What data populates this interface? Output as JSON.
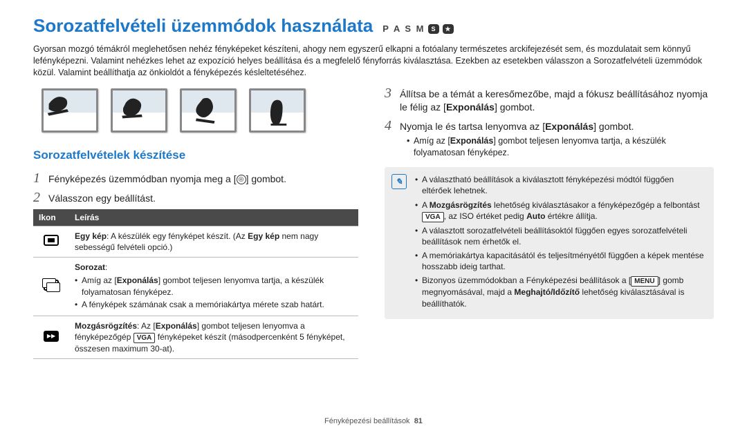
{
  "header": {
    "title": "Sorozatfelvételi üzemmódok használata",
    "mode_letters": "P A S M",
    "mode_badge1": "S",
    "mode_badge2": "★"
  },
  "intro": "Gyorsan mozgó témákról meglehetősen nehéz fényképeket készíteni, ahogy nem egyszerű elkapni a fotóalany természetes arckifejezését sem, és mozdulatait sem könnyű lefényképezni. Valamint nehézkes lehet az expozíció helyes beállítása és a megfelelő fényforrás kiválasztása. Ezekben az esetekben válasszon a Sorozatfelvételi üzemmódok közül. Valamint beállíthatja az önkioldót a fényképezés késleltetéséhez.",
  "section_sub": "Sorozatfelvételek készítése",
  "steps_left": {
    "s1_pre": "Fényképezés üzemmódban nyomja meg a [",
    "s1_post": "] gombot.",
    "s2": "Válasszon egy beállítást."
  },
  "table": {
    "h1": "Ikon",
    "h2": "Leírás",
    "r1_strong": "Egy kép",
    "r1_rest": ": A készülék egy fényképet készít. (Az ",
    "r1_strong2": "Egy kép",
    "r1_rest2": " nem nagy sebességű felvételi opció.)",
    "r2_strong": "Sorozat",
    "r2_rest": ":",
    "r2_b1_pre": "Amíg az [",
    "r2_b1_mid": "Exponálás",
    "r2_b1_post": "] gombot teljesen lenyomva tartja, a készülék folyamatosan fényképez.",
    "r2_b2": "A fényképek számának csak a memóriakártya mérete szab határt.",
    "r3_strong": "Mozgásrögzítés",
    "r3_rest_pre": ": Az [",
    "r3_rest_mid": "Exponálás",
    "r3_rest_post1": "] gombot teljesen lenyomva a fényképezőgép ",
    "r3_btn": "VGA",
    "r3_rest_post2": " fényképeket készít (másodpercenként 5 fényképet, összesen maximum 30-at)."
  },
  "steps_right": {
    "s3": "Állítsa be a témát a keresőmezőbe, majd a fókusz beállításához nyomja le félig az [",
    "s3_mid": "Exponálás",
    "s3_post": "] gombot.",
    "s4_pre": "Nyomja le és tartsa lenyomva az [",
    "s4_mid": "Exponálás",
    "s4_post": "] gombot.",
    "s4_b1_pre": "Amíg az [",
    "s4_b1_mid": "Exponálás",
    "s4_b1_post": "] gombot teljesen lenyomva tartja, a készülék folyamatosan fényképez."
  },
  "notes": {
    "n1": "A választható beállítások a kiválasztott fényképezési módtól függően eltérőek lehetnek.",
    "n2_pre": "A ",
    "n2_strong": "Mozgásrögzítés",
    "n2_mid": " lehetőség kiválasztásakor a fényképezőgép a felbontást ",
    "n2_btn": "VGA",
    "n2_post": ", az ISO értéket pedig ",
    "n2_strong2": "Auto",
    "n2_end": " értékre állítja.",
    "n3": "A választott sorozatfelvételi beállításoktól függően egyes sorozatfelvételi beállítások nem érhetők el.",
    "n4": "A memóriakártya kapacitásától és teljesítményétől függően a képek mentése hosszabb ideig tarthat.",
    "n5_pre": "Bizonyos üzemmódokban a Fényképezési beállítások a [",
    "n5_btn": "MENU",
    "n5_mid": "] gomb megnyomásával, majd a ",
    "n5_strong": "Meghajtó/Időzítő",
    "n5_post": " lehetőség kiválasztásával is beállíthatók."
  },
  "footer": {
    "section": "Fényképezési beállítások",
    "page": "81"
  }
}
